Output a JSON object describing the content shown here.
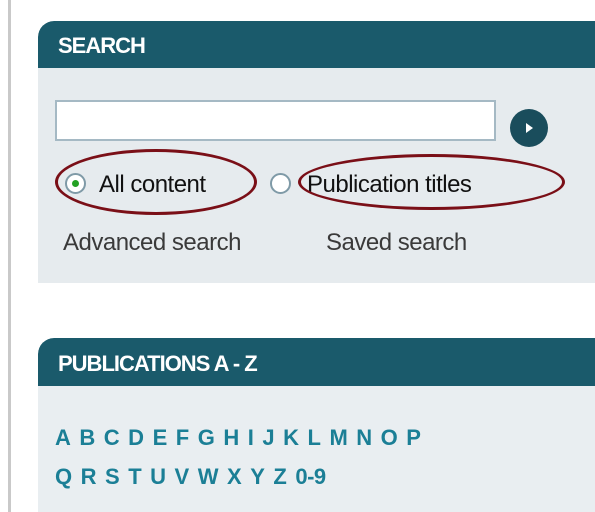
{
  "search": {
    "title": "SEARCH",
    "input_value": "",
    "options": [
      {
        "label": "All content",
        "selected": true
      },
      {
        "label": "Publication titles",
        "selected": false
      }
    ],
    "links": [
      "Advanced search",
      "Saved search"
    ],
    "icon": "arrow-right-icon",
    "annotation_color": "#7a0f17"
  },
  "publications": {
    "title": "PUBLICATIONS A - Z",
    "row1": [
      "A",
      "B",
      "C",
      "D",
      "E",
      "F",
      "G",
      "H",
      "I",
      "J",
      "K",
      "L",
      "M",
      "N",
      "O",
      "P"
    ],
    "row2": [
      "Q",
      "R",
      "S",
      "T",
      "U",
      "V",
      "W",
      "X",
      "Y",
      "Z",
      "0-9"
    ]
  },
  "colors": {
    "header_bg": "#1a5a6b",
    "panel_bg": "#e6ebee",
    "link_teal": "#1b7f96",
    "radio_selected": "#23a123"
  }
}
